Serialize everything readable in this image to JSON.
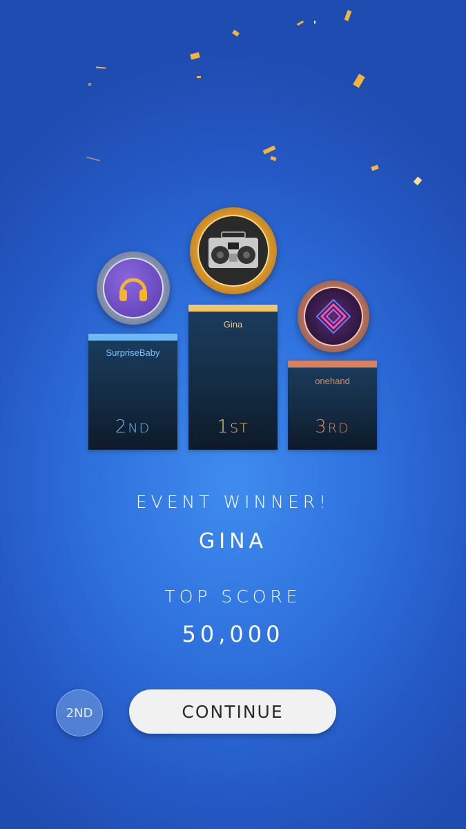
{
  "podium": {
    "first": {
      "name": "Gina",
      "rank_num": "1",
      "rank_suffix": "ST",
      "icon": "boombox-icon",
      "color": "#f3c56a"
    },
    "second": {
      "name": "SurpriseBaby",
      "rank_num": "2",
      "rank_suffix": "ND",
      "icon": "headphones-icon",
      "color": "#6fb7f5"
    },
    "third": {
      "name": "onehand",
      "rank_num": "3",
      "rank_suffix": "RD",
      "icon": "neon-diamond-icon",
      "color": "#e0865e"
    }
  },
  "result": {
    "event_label": "EVENT WINNER!",
    "winner_name": "GINA",
    "score_label": "TOP SCORE",
    "score_value": "50,000"
  },
  "actions": {
    "place_label": "2ND",
    "continue_label": "CONTINUE"
  },
  "colors": {
    "accent_gold": "#f3b33d",
    "background": "#2f72de"
  }
}
